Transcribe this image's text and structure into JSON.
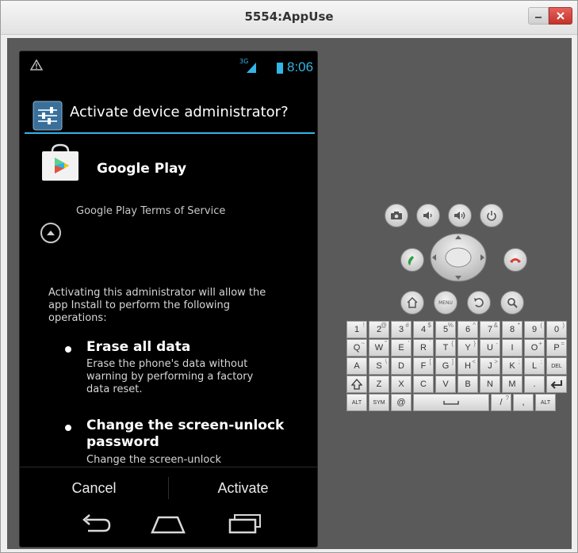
{
  "window": {
    "title": "5554:AppUse"
  },
  "statusbar": {
    "time": "8:06",
    "network": "3G"
  },
  "dialog": {
    "title": "Activate device administrator?",
    "app_name": "Google Play",
    "tos": "Google Play Terms of Service",
    "explain_lines": [
      "Activating this administrator will allow the",
      "app Install to perform the following",
      "operations:"
    ],
    "policies": [
      {
        "title_lines": [
          "Erase all data"
        ],
        "desc_lines": [
          "Erase the phone's data without",
          "warning by performing a factory",
          "data reset."
        ]
      },
      {
        "title_lines": [
          "Change the screen-unlock",
          "password"
        ],
        "desc_lines": [
          "Change the screen-unlock"
        ]
      }
    ],
    "cancel": "Cancel",
    "activate": "Activate"
  },
  "controls": {
    "menu_label": "MENU"
  },
  "keyboard": {
    "row1": [
      [
        "1",
        "!"
      ],
      [
        "2",
        "@"
      ],
      [
        "3",
        "#"
      ],
      [
        "4",
        "$"
      ],
      [
        "5",
        "%"
      ],
      [
        "6",
        "^"
      ],
      [
        "7",
        "&"
      ],
      [
        "8",
        "*"
      ],
      [
        "9",
        "("
      ],
      [
        "0",
        ")"
      ]
    ],
    "row2": [
      [
        "Q",
        "~"
      ],
      [
        "W",
        "\""
      ],
      [
        "E",
        "'"
      ],
      [
        "R",
        "`"
      ],
      [
        "T",
        "{"
      ],
      [
        "Y",
        "}"
      ],
      [
        "U",
        "-"
      ],
      [
        "I",
        ""
      ],
      [
        "O",
        "+"
      ],
      [
        "P",
        "="
      ]
    ],
    "row3": [
      [
        "A",
        ""
      ],
      [
        "S",
        "\\"
      ],
      [
        "D",
        ""
      ],
      [
        "F",
        "["
      ],
      [
        "G",
        "]"
      ],
      [
        "H",
        "<"
      ],
      [
        "J",
        ">"
      ],
      [
        "K",
        ";"
      ],
      [
        "L",
        ":"
      ],
      [
        "DEL",
        ""
      ]
    ],
    "row4": [
      [
        "Z",
        ""
      ],
      [
        "X",
        ""
      ],
      [
        "C",
        ""
      ],
      [
        "V",
        ""
      ],
      [
        "B",
        ""
      ],
      [
        "N",
        ""
      ],
      [
        "M",
        ""
      ],
      [
        ".",
        ""
      ]
    ],
    "row5_alt": "ALT",
    "row5_sym": "SYM",
    "row5_at": "@",
    "row5_slash": "/",
    "row5_q": "?",
    "row5_comma": ",",
    "row5_alt2": "ALT"
  }
}
